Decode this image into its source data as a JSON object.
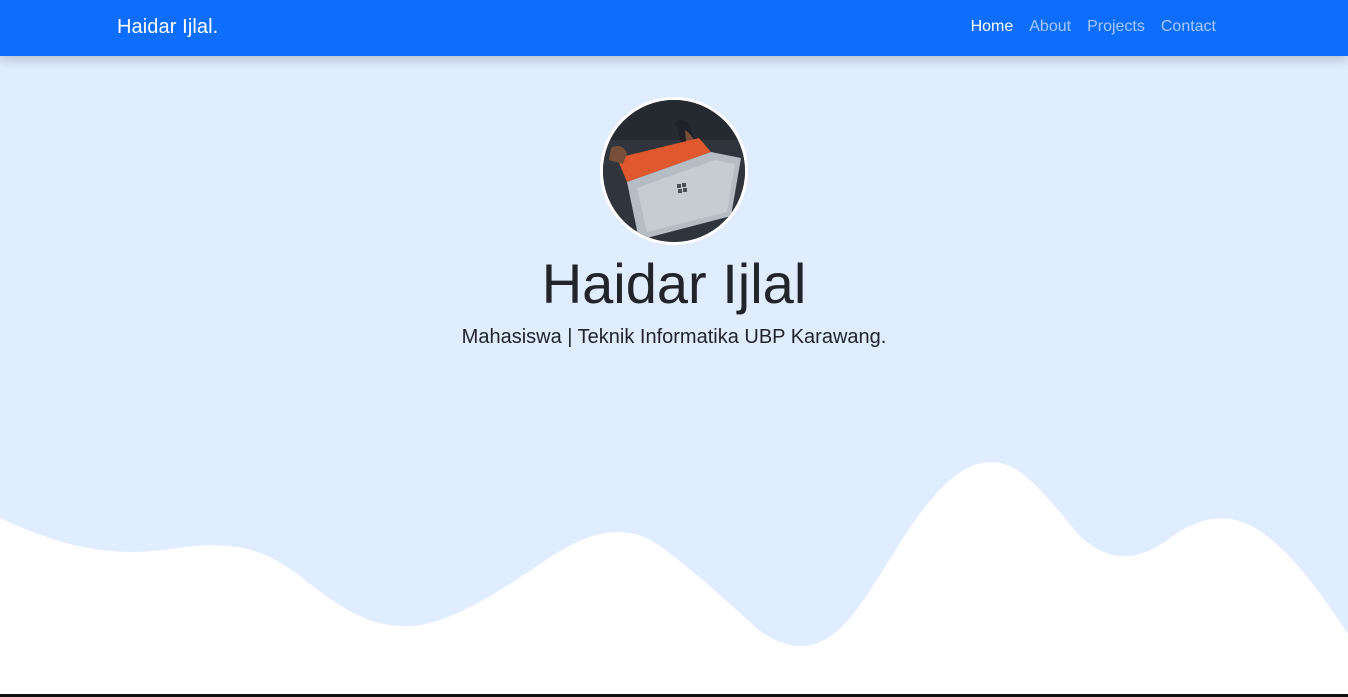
{
  "navbar": {
    "brand": "Haidar Ijlal.",
    "links": [
      {
        "label": "Home",
        "active": true
      },
      {
        "label": "About",
        "active": false
      },
      {
        "label": "Projects",
        "active": false
      },
      {
        "label": "Contact",
        "active": false
      }
    ]
  },
  "hero": {
    "name": "Haidar Ijlal",
    "subtitle": "Mahasiswa | Teknik Informatika UBP Karawang.",
    "avatar_icon": "profile-photo-laptop"
  },
  "colors": {
    "navbar_bg": "#0d6efd",
    "hero_bg": "#e0ecff",
    "wave_fill": "#ffffff"
  }
}
